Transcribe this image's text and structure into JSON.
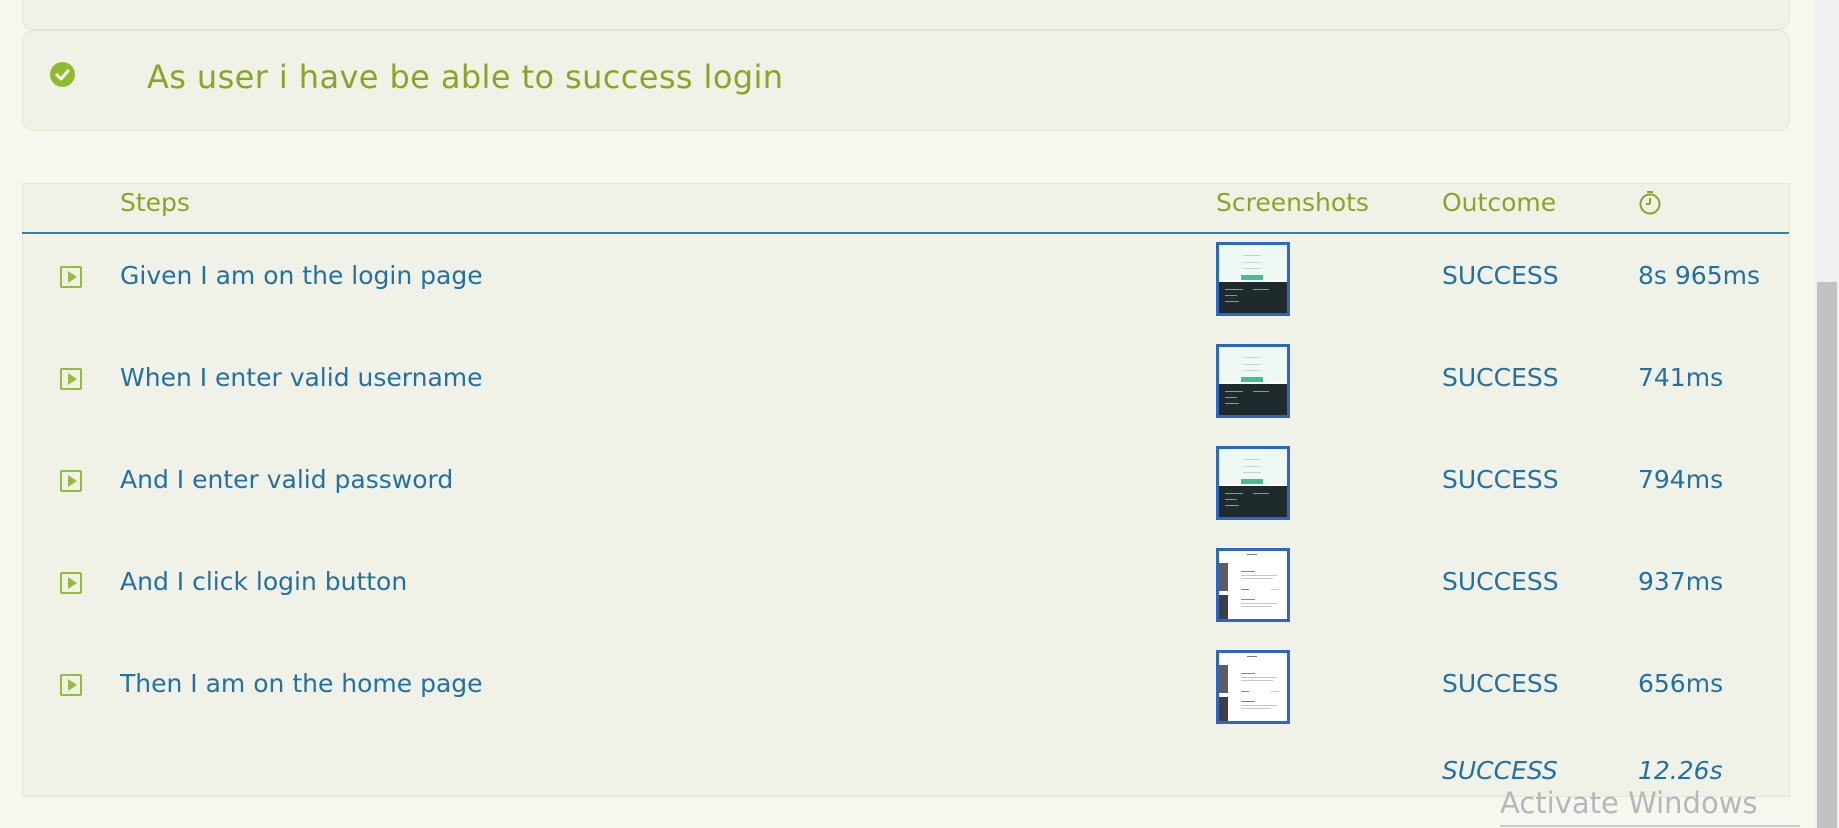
{
  "scenario": {
    "title": "As user i have be able to success login",
    "status_icon": "check-circle-icon",
    "status_color": "#8fbc2a"
  },
  "table": {
    "headers": {
      "steps": "Steps",
      "screenshots": "Screenshots",
      "outcome": "Outcome",
      "duration_icon": "stopwatch-icon"
    },
    "rows": [
      {
        "step": "Given I am on the login page",
        "outcome": "SUCCESS",
        "duration": "8s 965ms",
        "screenshot": "login-page"
      },
      {
        "step": "When I enter valid username",
        "outcome": "SUCCESS",
        "duration": "741ms",
        "screenshot": "login-page"
      },
      {
        "step": "And I enter valid password",
        "outcome": "SUCCESS",
        "duration": "794ms",
        "screenshot": "login-page"
      },
      {
        "step": "And I click login button",
        "outcome": "SUCCESS",
        "duration": "937ms",
        "screenshot": "home-page"
      },
      {
        "step": "Then I am on the home page",
        "outcome": "SUCCESS",
        "duration": "656ms",
        "screenshot": "home-page"
      }
    ],
    "total": {
      "outcome": "SUCCESS",
      "duration": "12.26s"
    }
  },
  "watermark": {
    "title": "Activate Windows"
  },
  "colors": {
    "accent_green": "#8aa526",
    "link_blue": "#2171a4",
    "header_rule": "#3b7fa6",
    "thumbnail_border": "#2d66c7"
  }
}
